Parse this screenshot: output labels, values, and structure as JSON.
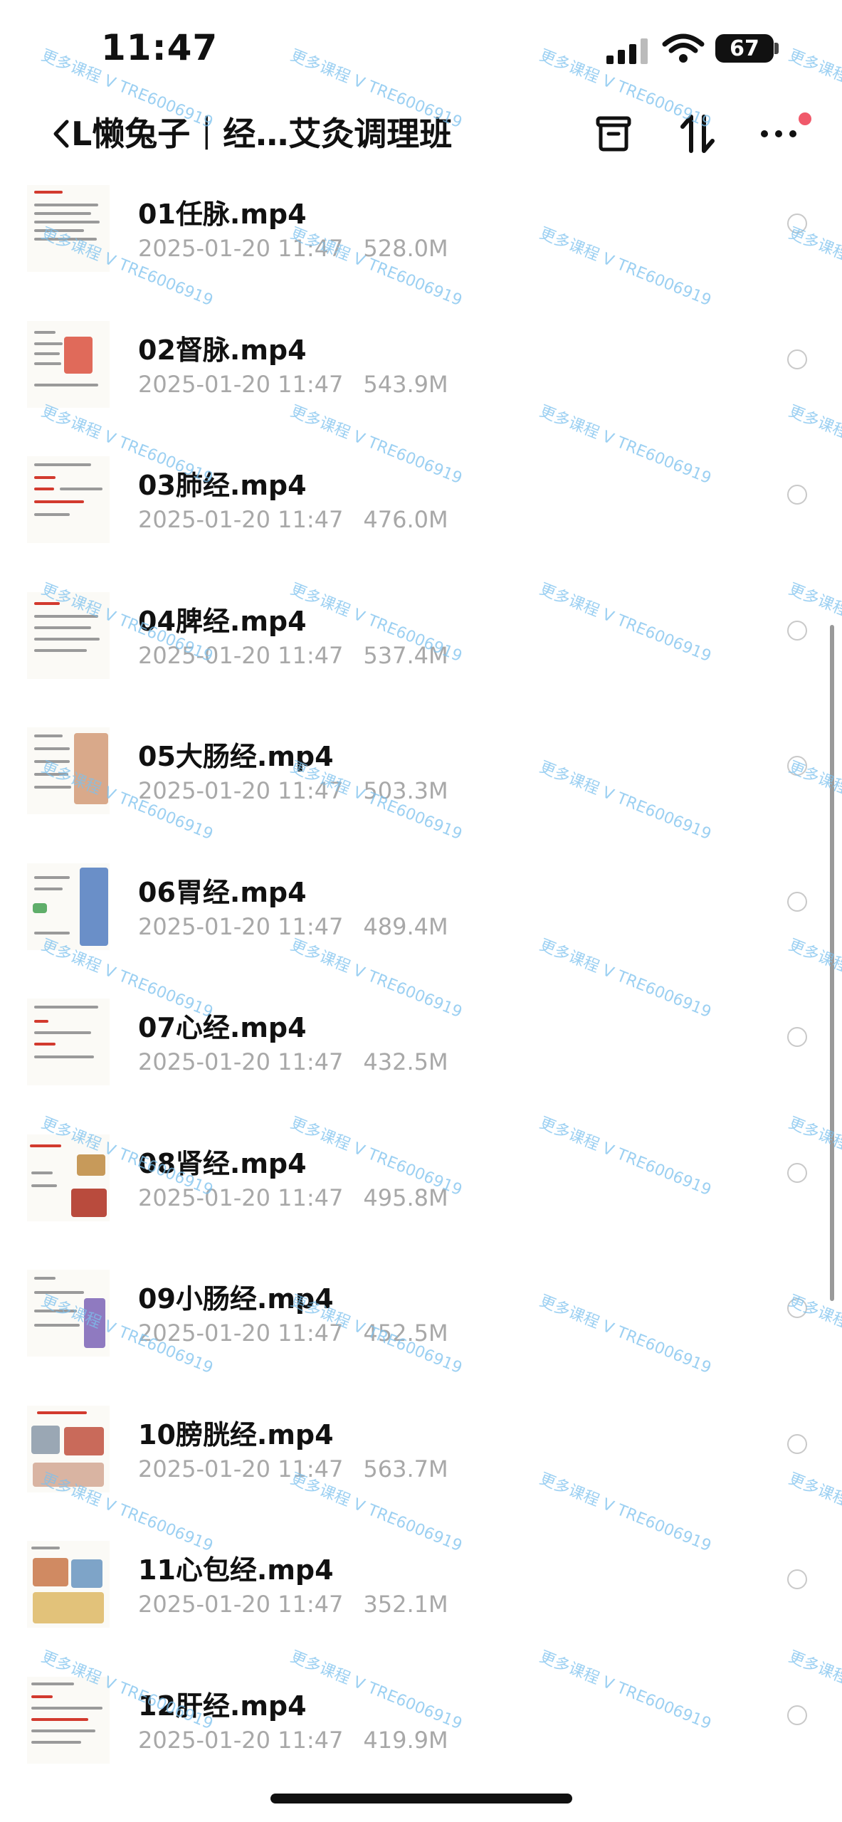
{
  "status_bar": {
    "time": "11:47",
    "battery": "67"
  },
  "nav": {
    "back_glyph": "<",
    "title": "L懒兔子｜经…艾灸调理班"
  },
  "icons": {
    "back": "chevron-left-icon",
    "box": "box-icon",
    "sort": "sort-icon",
    "more": "more-icon"
  },
  "files": [
    {
      "name": "01任脉.mp4",
      "date": "2025-01-20 11:47",
      "size": "528.0M"
    },
    {
      "name": "02督脉.mp4",
      "date": "2025-01-20 11:47",
      "size": "543.9M"
    },
    {
      "name": "03肺经.mp4",
      "date": "2025-01-20 11:47",
      "size": "476.0M"
    },
    {
      "name": "04脾经.mp4",
      "date": "2025-01-20 11:47",
      "size": "537.4M"
    },
    {
      "name": "05大肠经.mp4",
      "date": "2025-01-20 11:47",
      "size": "503.3M"
    },
    {
      "name": "06胃经.mp4",
      "date": "2025-01-20 11:47",
      "size": "489.4M"
    },
    {
      "name": "07心经.mp4",
      "date": "2025-01-20 11:47",
      "size": "432.5M"
    },
    {
      "name": "08肾经.mp4",
      "date": "2025-01-20 11:47",
      "size": "495.8M"
    },
    {
      "name": "09小肠经.mp4",
      "date": "2025-01-20 11:47",
      "size": "452.5M"
    },
    {
      "name": "10膀胱经.mp4",
      "date": "2025-01-20 11:47",
      "size": "563.7M"
    },
    {
      "name": "11心包经.mp4",
      "date": "2025-01-20 11:47",
      "size": "352.1M"
    },
    {
      "name": "12肝经.mp4",
      "date": "2025-01-20 11:47",
      "size": "419.9M"
    }
  ],
  "watermark": "更多课程 V TRE6006919",
  "colors": {
    "watermark": "#7cc1ee",
    "meta_text": "#a8a8a8",
    "notification_dot": "#f0596a"
  }
}
